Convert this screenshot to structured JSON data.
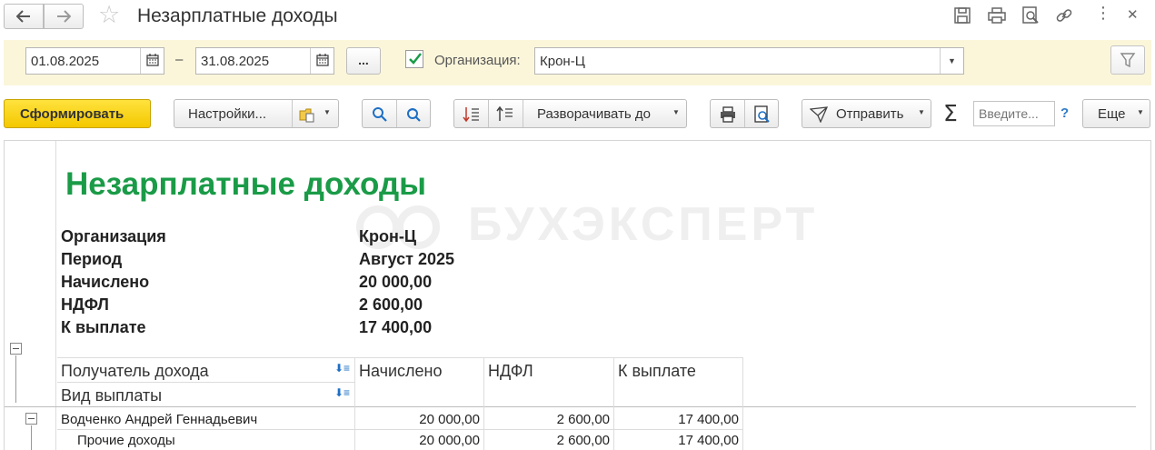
{
  "window": {
    "title": "Незарплатные доходы",
    "back_glyph": "🡐",
    "forward_glyph": "🡒",
    "more_glyph": "⋮",
    "close_glyph": "✕"
  },
  "filter": {
    "date_from": "01.08.2025",
    "date_to": "31.08.2025",
    "dash": "–",
    "dots_label": "...",
    "org_checked": true,
    "org_label": "Организация:",
    "org_value": "Крон-Ц"
  },
  "commands": {
    "generate": "Сформировать",
    "settings": "Настройки...",
    "expand_to": "Разворачивать до",
    "send": "Отправить",
    "search_placeholder": "Введите...",
    "help": "?",
    "more": "Еще",
    "sigma": "Σ"
  },
  "report": {
    "title": "Незарплатные доходы",
    "watermark": "БУХЭКСПЕРТ",
    "info": [
      {
        "label": "Организация",
        "value": "Крон-Ц"
      },
      {
        "label": "Период",
        "value": "Август 2025"
      },
      {
        "label": "Начислено",
        "value": "20 000,00"
      },
      {
        "label": "НДФЛ",
        "value": "2 600,00"
      },
      {
        "label": "К выплате",
        "value": "17 400,00"
      }
    ],
    "columns": {
      "recipient": "Получатель дохода",
      "payment_type": "Вид выплаты",
      "accrued": "Начислено",
      "ndfl": "НДФЛ",
      "to_pay": "К выплате"
    },
    "rows": [
      {
        "name": "Водченко Андрей Геннадьевич",
        "accrued": "20 000,00",
        "ndfl": "2 600,00",
        "to_pay": "17 400,00"
      },
      {
        "name": "Прочие доходы",
        "accrued": "20 000,00",
        "ndfl": "2 600,00",
        "to_pay": "17 400,00"
      }
    ]
  },
  "colors": {
    "accent_yellow": "#f4c800",
    "filter_bg": "#fbf6da",
    "title_green": "#1a9b47",
    "link_blue": "#2f7bc7"
  }
}
